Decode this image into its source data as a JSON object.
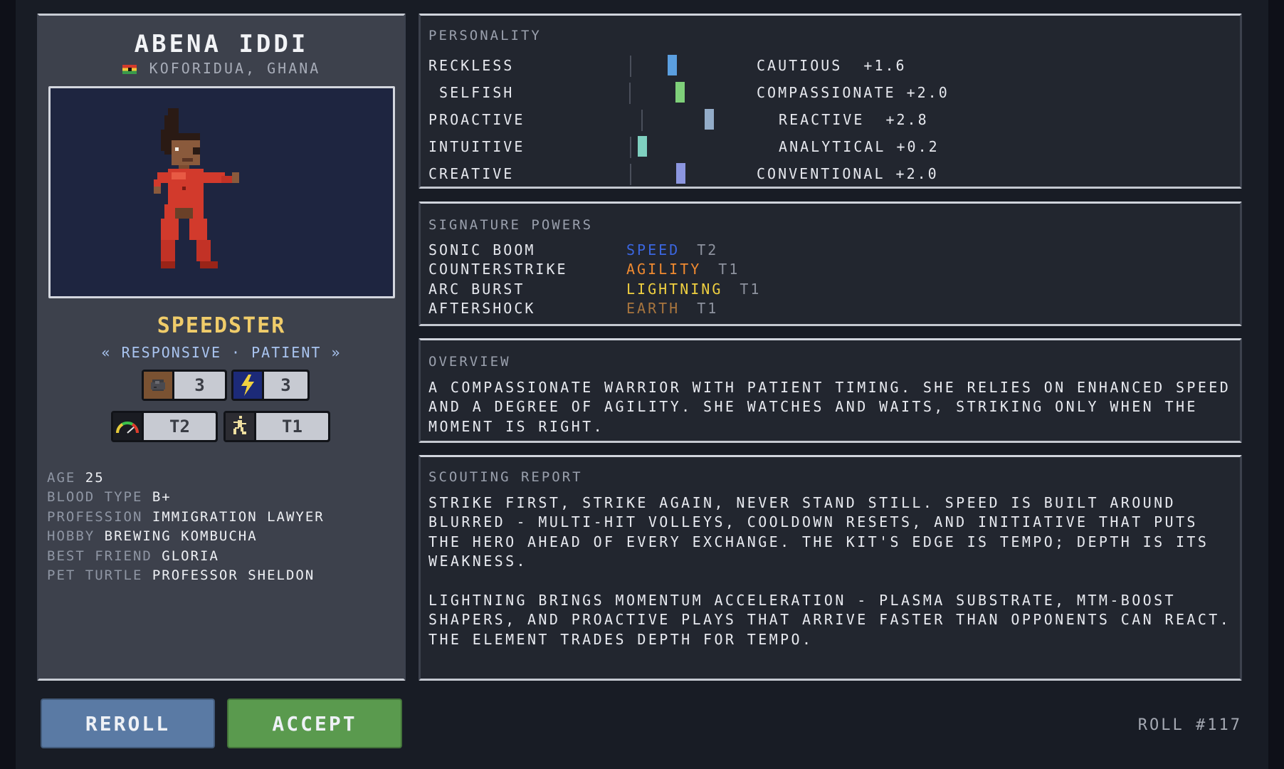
{
  "hero": {
    "name": "ABENA IDDI",
    "location": "KOFORIDUA, GHANA",
    "archetype": "SPEEDSTER",
    "traits": "« RESPONSIVE · PATIENT »",
    "badges": [
      {
        "icon": "earth-rock-icon",
        "value": "3"
      },
      {
        "icon": "lightning-icon",
        "value": "3"
      },
      {
        "icon": "speedometer-icon",
        "value": "T2"
      },
      {
        "icon": "agility-runner-icon",
        "value": "T1"
      }
    ],
    "stats": [
      {
        "key": "AGE",
        "value": "25"
      },
      {
        "key": "BLOOD TYPE",
        "value": "B+"
      },
      {
        "key": "PROFESSION",
        "value": "IMMIGRATION LAWYER"
      },
      {
        "key": "HOBBY",
        "value": "BREWING KOMBUCHA"
      },
      {
        "key": "BEST FRIEND",
        "value": "GLORIA"
      },
      {
        "key": "PET TURTLE",
        "value": "PROFESSOR SHELDON"
      }
    ]
  },
  "personality": {
    "title": "PERSONALITY",
    "rows": [
      {
        "left": "RECKLESS",
        "right": "CAUTIOUS  +1.6",
        "level": 1.6,
        "color": "#5b9fe0"
      },
      {
        "left": " SELFISH",
        "right": "COMPASSIONATE +2.0",
        "level": 2.0,
        "color": "#7fd07a"
      },
      {
        "left": "PROACTIVE",
        "right": " REACTIVE  +2.8",
        "level": 2.8,
        "color": "#93acc8"
      },
      {
        "left": "INTUITIVE",
        "right": " ANALYTICAL +0.2",
        "level": 0.2,
        "color": "#7fd0c0"
      },
      {
        "left": "CREATIVE",
        "right": "CONVENTIONAL +2.0",
        "level": 2.0,
        "color": "#8c96e0"
      }
    ]
  },
  "powers": {
    "title": "SIGNATURE POWERS",
    "items": [
      {
        "name": "SONIC BOOM",
        "element": "SPEED",
        "color": "#3b66e0",
        "tier": "T2"
      },
      {
        "name": "COUNTERSTRIKE",
        "element": "AGILITY",
        "color": "#f08a30",
        "tier": "T1"
      },
      {
        "name": "ARC BURST",
        "element": "LIGHTNING",
        "color": "#f0d040",
        "tier": "T1"
      },
      {
        "name": "AFTERSHOCK",
        "element": "EARTH",
        "color": "#a8753e",
        "tier": "T1"
      }
    ]
  },
  "overview": {
    "title": "OVERVIEW",
    "text": "A COMPASSIONATE WARRIOR WITH PATIENT TIMING. SHE RELIES ON ENHANCED SPEED AND A DEGREE OF AGILITY. SHE WATCHES AND WAITS, STRIKING ONLY WHEN THE MOMENT IS RIGHT."
  },
  "scouting": {
    "title": "SCOUTING REPORT",
    "p1": "STRIKE FIRST, STRIKE AGAIN, NEVER STAND STILL. SPEED IS BUILT AROUND BLURRED - MULTI-HIT VOLLEYS, COOLDOWN RESETS, AND INITIATIVE THAT PUTS THE HERO AHEAD OF EVERY EXCHANGE. THE KIT'S EDGE IS TEMPO; DEPTH IS ITS WEAKNESS.",
    "p2": "LIGHTNING BRINGS MOMENTUM ACCELERATION - PLASMA SUBSTRATE, MTM-BOOST SHAPERS, AND PROACTIVE PLAYS THAT ARRIVE FASTER THAN OPPONENTS CAN REACT. THE ELEMENT TRADES DEPTH FOR TEMPO."
  },
  "actions": {
    "reroll": "REROLL",
    "accept": "ACCEPT",
    "roll": "ROLL #117"
  }
}
